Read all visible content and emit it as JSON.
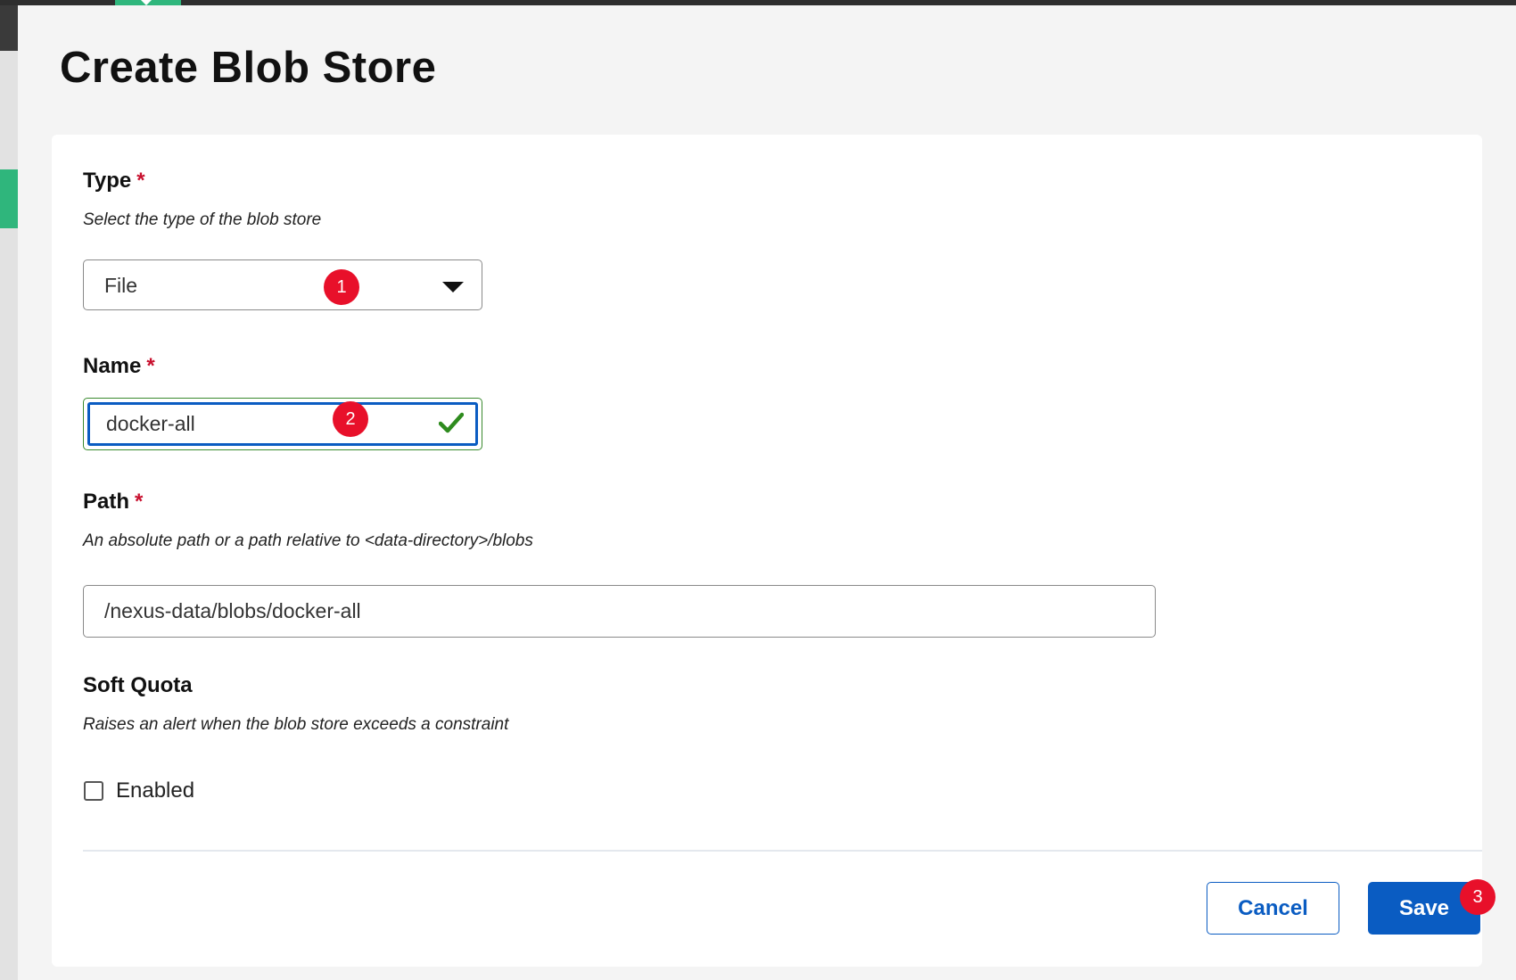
{
  "page": {
    "title": "Create Blob Store"
  },
  "form": {
    "type": {
      "label": "Type",
      "required_mark": "*",
      "help": "Select the type of the blob store",
      "selected": "File"
    },
    "name": {
      "label": "Name",
      "required_mark": "*",
      "value": "docker-all",
      "valid": true
    },
    "path": {
      "label": "Path",
      "required_mark": "*",
      "help": "An absolute path or a path relative to <data-directory>/blobs",
      "value": "/nexus-data/blobs/docker-all"
    },
    "soft_quota": {
      "label": "Soft Quota",
      "help": "Raises an alert when the blob store exceeds a constraint",
      "checkbox_label": "Enabled",
      "checked": false
    }
  },
  "actions": {
    "cancel_label": "Cancel",
    "save_label": "Save"
  },
  "markers": [
    "1",
    "2",
    "3"
  ],
  "colors": {
    "accent_blue": "#0a5cc2",
    "required_red": "#c8102e",
    "valid_green": "#2e8b1e",
    "nav_green": "#2fb67c",
    "marker_red": "#e8102a"
  },
  "icons": {
    "select_caret": "caret-down-icon",
    "name_valid": "checkmark-icon"
  }
}
